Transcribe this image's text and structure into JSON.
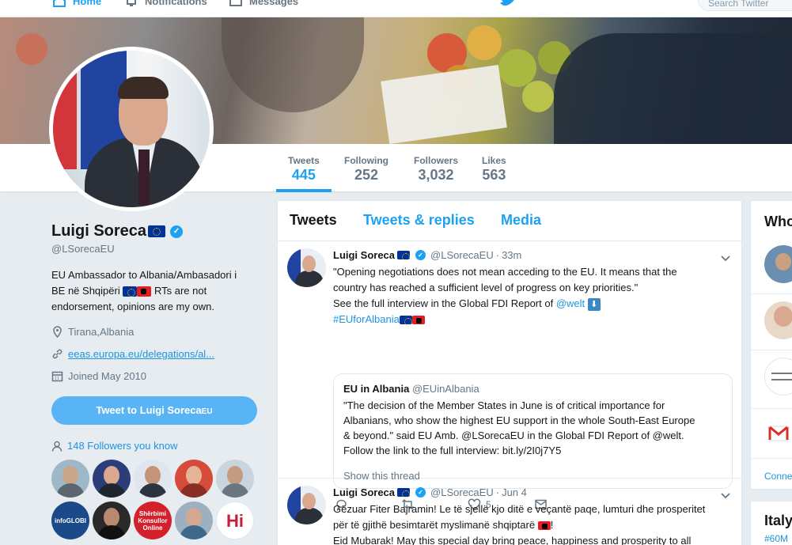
{
  "topnav": {
    "home": "Home",
    "notifications": "Notifications",
    "messages": "Messages",
    "search_placeholder": "Search Twitter"
  },
  "stats": {
    "tweets": {
      "label": "Tweets",
      "value": "445"
    },
    "following": {
      "label": "Following",
      "value": "252"
    },
    "followers": {
      "label": "Followers",
      "value": "3,032"
    },
    "likes": {
      "label": "Likes",
      "value": "563"
    }
  },
  "profile": {
    "name": "Luigi Soreca",
    "handle": "@LSorecaEU",
    "bio_1": "EU Ambassador to Albania/Ambasadori i",
    "bio_2_a": "BE në Shqipëri",
    "bio_2_b": "RTs are not",
    "bio_3": "endorsement, opinions are my own.",
    "location": "Tirana,Albania",
    "website": "eeas.europa.eu/delegations/al...",
    "joined": "Joined May 2010",
    "tweet_to_button": "Tweet to Luigi Soreca",
    "tweet_to_suffix": "EU",
    "followers_you_know": "148 Followers you know",
    "known_avatars": [
      "",
      "",
      "",
      "",
      "",
      "infoGLOBI",
      "",
      "Shërbimi Konsullor Online",
      "",
      "Hi"
    ]
  },
  "tabs": [
    "Tweets",
    "Tweets & replies",
    "Media"
  ],
  "tweets": [
    {
      "name": "Luigi Soreca",
      "handle": "@LSorecaEU",
      "time": "33m",
      "lines": [
        "\"Opening negotiations does not mean acceding to the EU. It means that the",
        "country has reached a sufficient level of progress on key priorities.\""
      ],
      "line3": "See the full interview in the Global FDI Report of",
      "mention": "@welt",
      "hashtag": "#EUforAlbania",
      "quote": {
        "name": "EU in Albania",
        "handle": "@EUinAlbania",
        "lines": [
          "\"The decision of the Member States in June is of critical importance for",
          "Albanians, who show the highest EU support in the whole South-East Europe",
          "& beyond.\" said EU Amb. @LSorecaEU in the Global FDI Report of @welt.",
          "Follow the link to the full interview: bit.ly/2I0j7Y5"
        ],
        "show_thread": "Show this thread"
      },
      "likes": "5"
    },
    {
      "name": "Luigi Soreca",
      "handle": "@LSorecaEU",
      "time": "Jun 4",
      "line1": "Gëzuar Fiter Bajramin! Le të sjellë kjo ditë e veçantë paqe, lumturi dhe prosperitet",
      "line2": "për të gjithë besimtarët myslimanë shqiptarë",
      "line3": "Eid Mubarak! May this special day bring peace, happiness and prosperity to all"
    }
  ],
  "sidebar": {
    "who_to_follow": "Who to follow",
    "connect": "Connect",
    "trends_title": "Italy trends",
    "trend_1": "#60M"
  },
  "colors": {
    "accent": "#1da1f2",
    "link": "#1b95e0",
    "background": "#e6ecf0"
  }
}
